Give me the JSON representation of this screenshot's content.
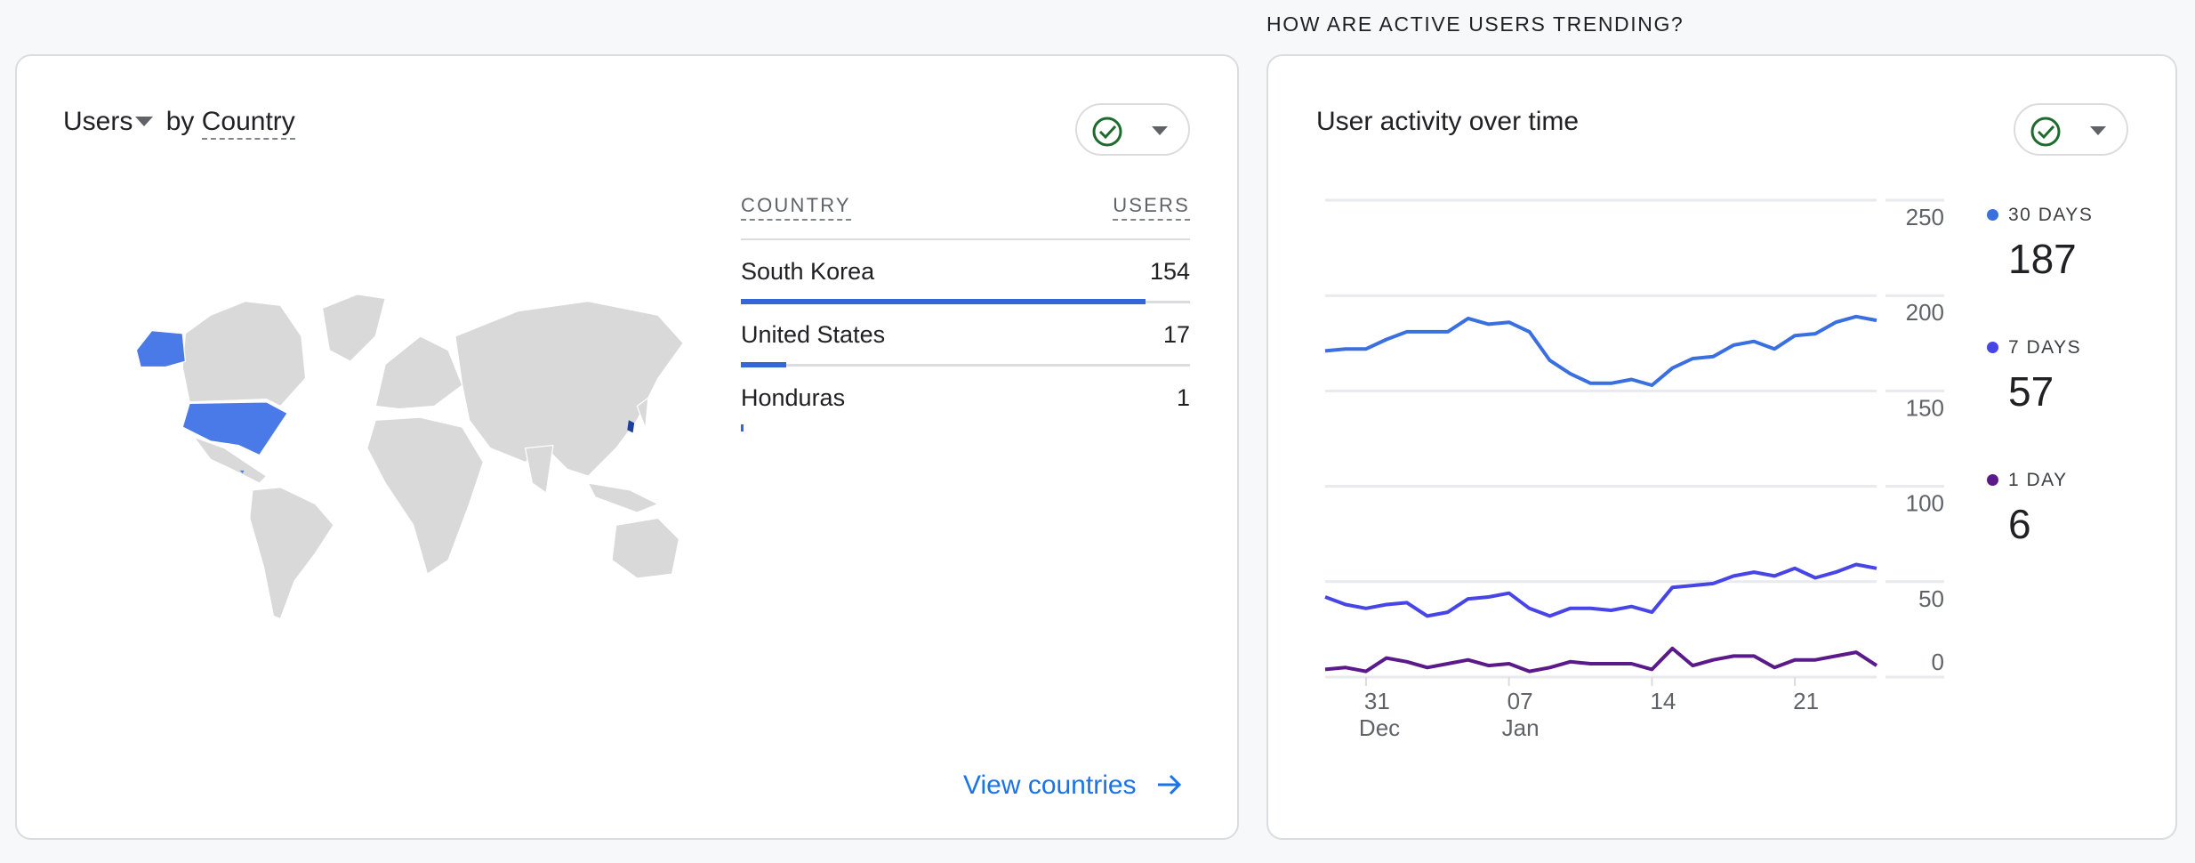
{
  "section_heading": "HOW ARE ACTIVE USERS TRENDING?",
  "country_card": {
    "title_metric": "Users",
    "title_by": "by",
    "title_dimension": "Country",
    "status_icon": "check-circle-icon",
    "table": {
      "headers": [
        "COUNTRY",
        "USERS"
      ],
      "rows": [
        {
          "country": "South Korea",
          "users": "154",
          "share": 0.9
        },
        {
          "country": "United States",
          "users": "17",
          "share": 0.1
        },
        {
          "country": "Honduras",
          "users": "1",
          "share": 0.006
        }
      ]
    },
    "map_highlight_color": "#4a79e8",
    "link_label": "View countries",
    "link_icon": "arrow-right-icon"
  },
  "activity_card": {
    "title": "User activity over time",
    "status_icon": "check-circle-icon",
    "legend": [
      {
        "label": "30 DAYS",
        "value": "187",
        "color": "#3a6fe0"
      },
      {
        "label": "7 DAYS",
        "value": "57",
        "color": "#4845e6"
      },
      {
        "label": "1 DAY",
        "value": "6",
        "color": "#5b1a8a"
      }
    ]
  },
  "chart_data": {
    "type": "line",
    "x": [
      "Dec 29",
      "Dec 30",
      "Dec 31",
      "Jan 1",
      "Jan 2",
      "Jan 3",
      "Jan 4",
      "Jan 5",
      "Jan 6",
      "Jan 7",
      "Jan 8",
      "Jan 9",
      "Jan 10",
      "Jan 11",
      "Jan 12",
      "Jan 13",
      "Jan 14",
      "Jan 15",
      "Jan 16",
      "Jan 17",
      "Jan 18",
      "Jan 19",
      "Jan 20",
      "Jan 21",
      "Jan 22",
      "Jan 23",
      "Jan 24",
      "Jan 25"
    ],
    "x_ticks": [
      {
        "index": 2,
        "label": "31",
        "sub": "Dec"
      },
      {
        "index": 9,
        "label": "07",
        "sub": "Jan"
      },
      {
        "index": 16,
        "label": "14",
        "sub": ""
      },
      {
        "index": 23,
        "label": "21",
        "sub": ""
      }
    ],
    "y_ticks": [
      0,
      50,
      100,
      150,
      200,
      250
    ],
    "ylim": [
      0,
      250
    ],
    "y_axis_side": "right",
    "grid": true,
    "legend_placement": "right",
    "series": [
      {
        "name": "30 DAYS",
        "color": "#3a6fe0",
        "values": [
          171,
          172,
          172,
          177,
          181,
          181,
          181,
          188,
          185,
          186,
          181,
          166,
          159,
          154,
          154,
          156,
          153,
          162,
          167,
          168,
          174,
          176,
          172,
          179,
          180,
          186,
          189,
          187
        ]
      },
      {
        "name": "7 DAYS",
        "color": "#4845e6",
        "values": [
          42,
          38,
          36,
          38,
          39,
          32,
          34,
          41,
          42,
          44,
          36,
          32,
          36,
          36,
          35,
          37,
          34,
          47,
          48,
          49,
          53,
          55,
          53,
          57,
          52,
          55,
          59,
          57
        ]
      },
      {
        "name": "1 DAY",
        "color": "#5b1a8a",
        "values": [
          4,
          5,
          3,
          10,
          8,
          5,
          7,
          9,
          6,
          7,
          3,
          5,
          8,
          7,
          7,
          7,
          4,
          15,
          6,
          9,
          11,
          11,
          5,
          9,
          9,
          11,
          13,
          6
        ]
      }
    ]
  }
}
